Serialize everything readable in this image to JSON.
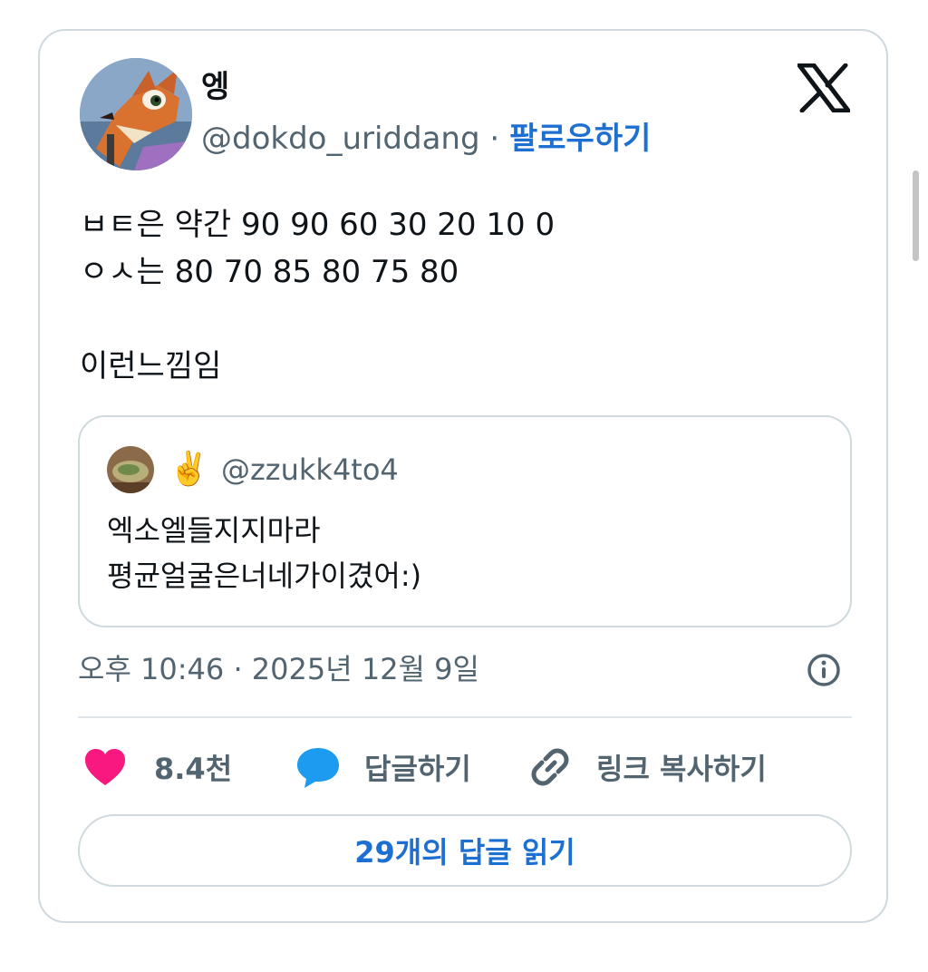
{
  "author": {
    "display_name": "엥",
    "handle": "@dokdo_uriddang",
    "separator": "·",
    "follow_label": "팔로우하기"
  },
  "tweet": {
    "lines": [
      "ㅂㅌ은 약간 90 90 60 30 20 10 0",
      "ㅇㅅ는 80 70 85 80 75 80",
      "",
      "이런느낌임"
    ]
  },
  "quote": {
    "emoji": "✌️",
    "handle": "@zzukk4to4",
    "lines": [
      "엑소엘들지지마라",
      "평균얼굴은너네가이겼어:)"
    ]
  },
  "timestamp": "오후 10:46 · 2025년 12월 9일",
  "actions": {
    "like_count": "8.4천",
    "reply_label": "답글하기",
    "copy_link_label": "링크 복사하기"
  },
  "replies_button": "29개의 답글 읽기",
  "colors": {
    "like": "#f91880",
    "reply": "#1d9bf0",
    "link": "#1d6fd1",
    "muted": "#536471",
    "border": "#cfd9de"
  }
}
